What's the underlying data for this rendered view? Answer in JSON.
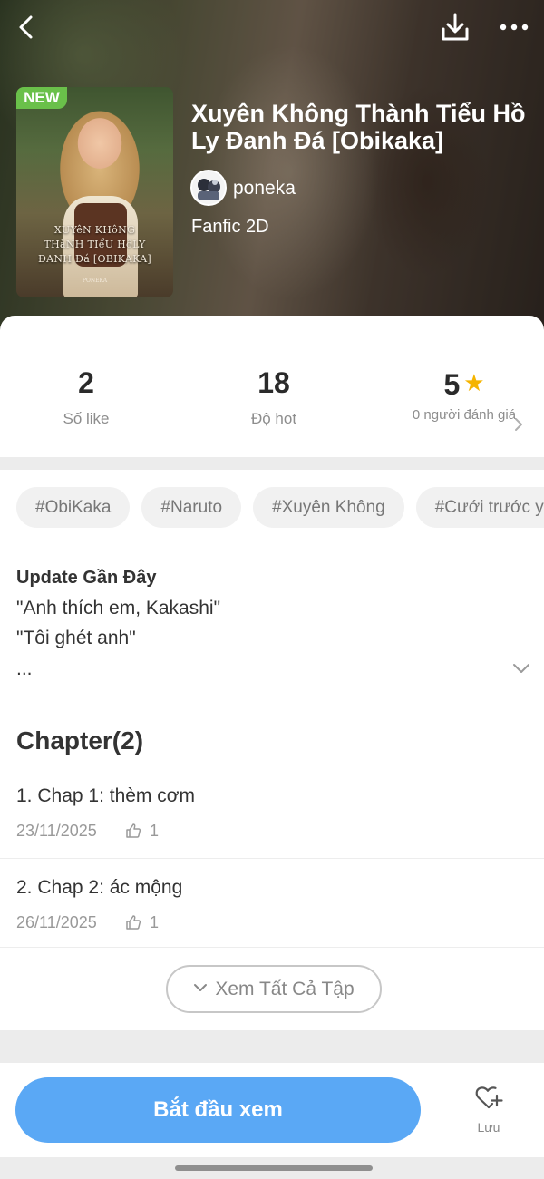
{
  "header": {
    "badge": "NEW",
    "cover_title": "XUYêN KHôNG\nTHàNH TIểU HồLY\nĐANH Đá [OBIKAKA]",
    "cover_author": "PONEKA",
    "title": "Xuyên Không Thành Tiểu Hồ Ly Đanh Đá [Obikaka]",
    "author": "poneka",
    "genre": "Fanfic 2D",
    "icons": [
      "back-arrow-icon",
      "download-icon",
      "more-icon"
    ]
  },
  "stats": {
    "likes": {
      "value": "2",
      "label": "Số like"
    },
    "hot": {
      "value": "18",
      "label": "Độ hot"
    },
    "rating": {
      "value": "5",
      "label": "0 người đánh giá"
    }
  },
  "tags": [
    "#ObiKaka",
    "#Naruto",
    "#Xuyên Không",
    "#Cưới trước yêu sau"
  ],
  "update": {
    "heading": "Update Gần Đây",
    "lines": [
      "\"Anh thích em, Kakashi\"",
      "\"Tôi ghét anh\"",
      "..."
    ]
  },
  "chapters": {
    "heading": "Chapter(2)",
    "items": [
      {
        "title": "1. Chap 1: thèm cơm",
        "date": "23/11/2025",
        "likes": "1"
      },
      {
        "title": "2. Chap 2: ác mộng",
        "date": "26/11/2025",
        "likes": "1"
      }
    ],
    "see_all": "Xem Tất Cả Tập"
  },
  "bottom": {
    "start": "Bắt đầu xem",
    "save": "Lưu"
  },
  "colors": {
    "primary": "#5aa8f5",
    "badge": "#6ac04a",
    "star": "#f5b400"
  }
}
